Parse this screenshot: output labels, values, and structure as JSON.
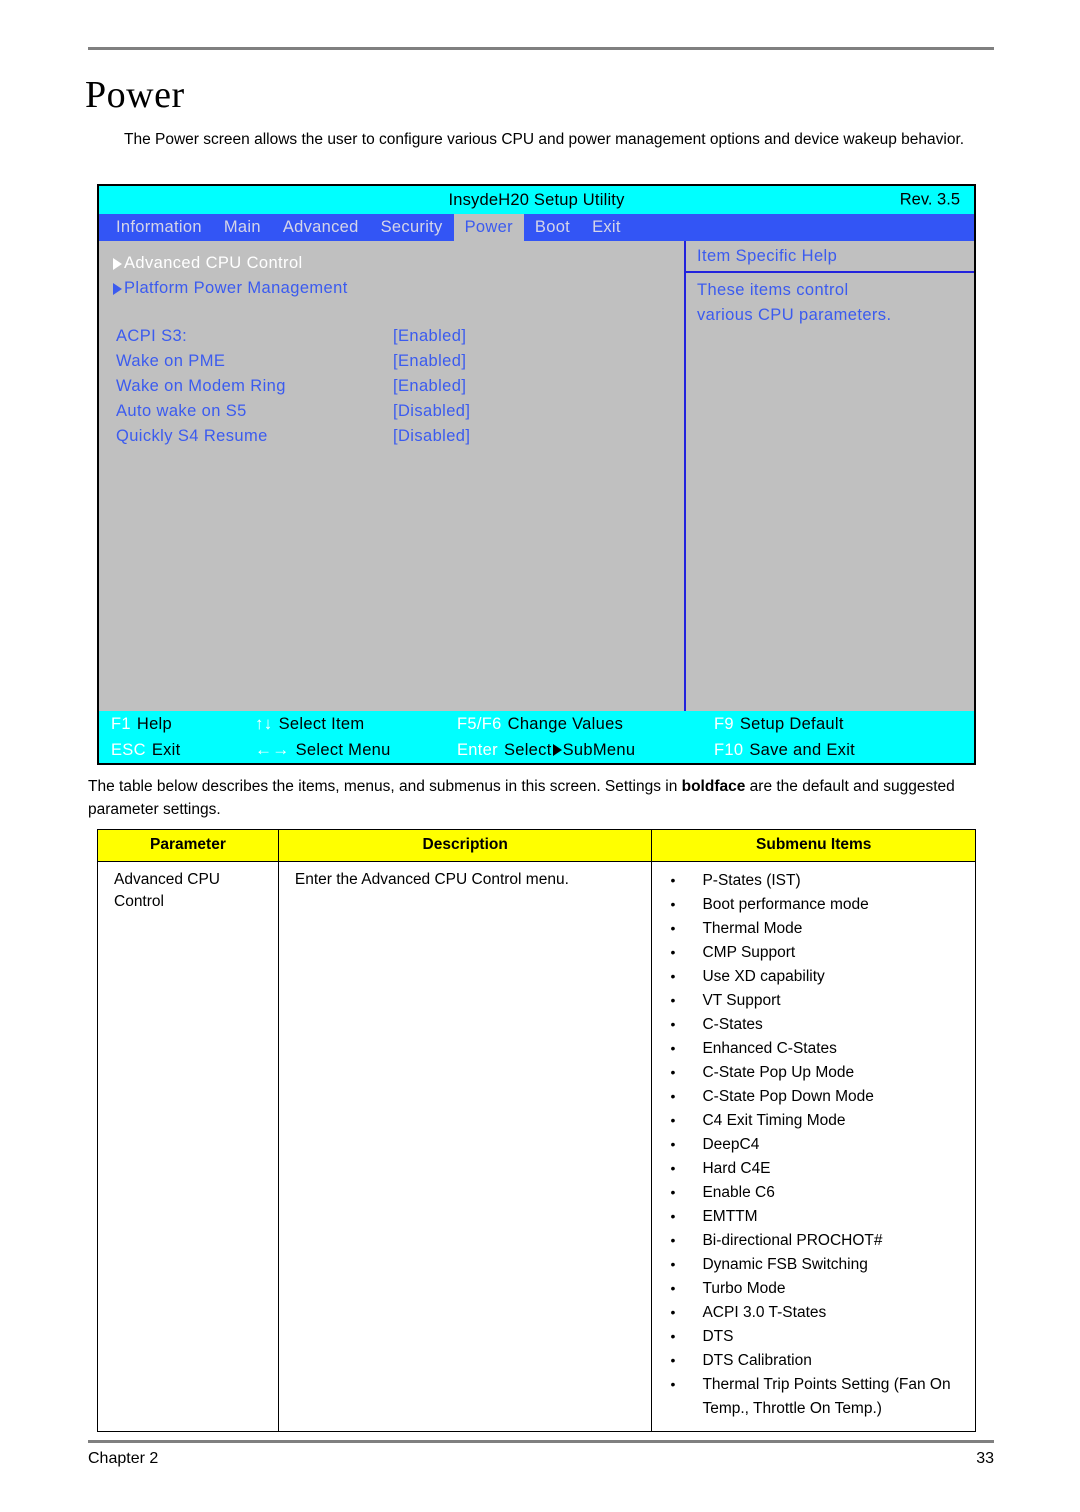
{
  "document": {
    "heading": "Power",
    "intro": "The Power screen allows the user to configure various CPU and power management options and device wakeup behavior.",
    "below_table_text_part1": "The table below describes the items, menus, and submenus in this screen. Settings in ",
    "below_table_bold": "boldface",
    "below_table_text_part2": " are the default and suggested parameter settings.",
    "footer_left": "Chapter 2",
    "footer_right": "33"
  },
  "bios": {
    "title": "InsydeH20 Setup Utility",
    "revision": "Rev. 3.5",
    "tabs": [
      {
        "label": "Information",
        "active": false
      },
      {
        "label": "Main",
        "active": false
      },
      {
        "label": "Advanced",
        "active": false
      },
      {
        "label": "Security",
        "active": false
      },
      {
        "label": "Power",
        "active": true
      },
      {
        "label": "Boot",
        "active": false
      },
      {
        "label": "Exit",
        "active": false
      }
    ],
    "submenus": [
      {
        "label": "Advanced CPU Control",
        "selected": true
      },
      {
        "label": "Platform Power Management",
        "selected": false
      }
    ],
    "options": [
      {
        "label": "ACPI S3:",
        "value": "[Enabled]"
      },
      {
        "label": "Wake on PME",
        "value": "[Enabled]"
      },
      {
        "label": "Wake on Modem Ring",
        "value": "[Enabled]"
      },
      {
        "label": "Auto wake on S5",
        "value": "[Disabled]"
      },
      {
        "label": "Quickly S4 Resume",
        "value": "[Disabled]"
      }
    ],
    "help": {
      "title": "Item Specific Help",
      "line1": "These items control",
      "line2": "various CPU parameters."
    },
    "keybar": [
      {
        "key": "F1",
        "desc": "Help"
      },
      {
        "key": "↑↓",
        "desc": "Select Item"
      },
      {
        "key": "F5/F6",
        "desc": "Change Values"
      },
      {
        "key": "F9",
        "desc": "Setup Default"
      },
      {
        "key": "ESC",
        "desc": "Exit"
      },
      {
        "key": "←→",
        "desc": "Select Menu"
      },
      {
        "key": "Enter",
        "desc_before": "Select",
        "desc_after": "SubMenu"
      },
      {
        "key": "F10",
        "desc": "Save and Exit"
      }
    ],
    "colors": {
      "titlebar": "#00ffff",
      "tabbar": "#3355f5",
      "screen_bg": "#c0c0c0",
      "text_blue": "#3b5bef",
      "keybar": "#00ffff"
    }
  },
  "table": {
    "headers": [
      "Parameter",
      "Description",
      "Submenu Items"
    ],
    "rows": [
      {
        "parameter": "Advanced CPU Control",
        "description": "Enter the Advanced CPU Control menu.",
        "submenu_items": [
          "P-States (IST)",
          "Boot performance mode",
          "Thermal Mode",
          "CMP Support",
          "Use XD capability",
          "VT Support",
          "C-States",
          "Enhanced C-States",
          "C-State Pop Up Mode",
          "C-State Pop Down Mode",
          "C4 Exit Timing Mode",
          "DeepC4",
          "Hard C4E",
          "Enable C6",
          "EMTTM",
          "Bi-directional PROCHOT#",
          "Dynamic FSB Switching",
          "Turbo Mode",
          "ACPI 3.0 T-States",
          "DTS",
          "DTS Calibration",
          "Thermal Trip Points Setting (Fan On Temp., Throttle On Temp.)"
        ]
      }
    ]
  }
}
